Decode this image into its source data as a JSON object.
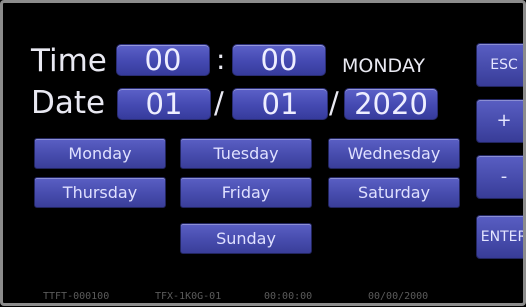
{
  "clock": {
    "time_label": "Time",
    "hour": "00",
    "time_sep": ":",
    "minute": "00",
    "weekday": "MONDAY",
    "date_label": "Date",
    "day": "01",
    "date_sep1": "/",
    "month": "01",
    "date_sep2": "/",
    "year": "2020"
  },
  "days": [
    "Monday",
    "Tuesday",
    "Wednesday",
    "Thursday",
    "Friday",
    "Saturday",
    "Sunday"
  ],
  "side": {
    "esc": "ESC",
    "plus": "+",
    "minus": "-",
    "enter": "ENTER"
  },
  "status": {
    "model": "TTFT-000100",
    "firmware": "TFX-1K0G-01",
    "time": "00:00:00",
    "date": "00/00/2000"
  }
}
